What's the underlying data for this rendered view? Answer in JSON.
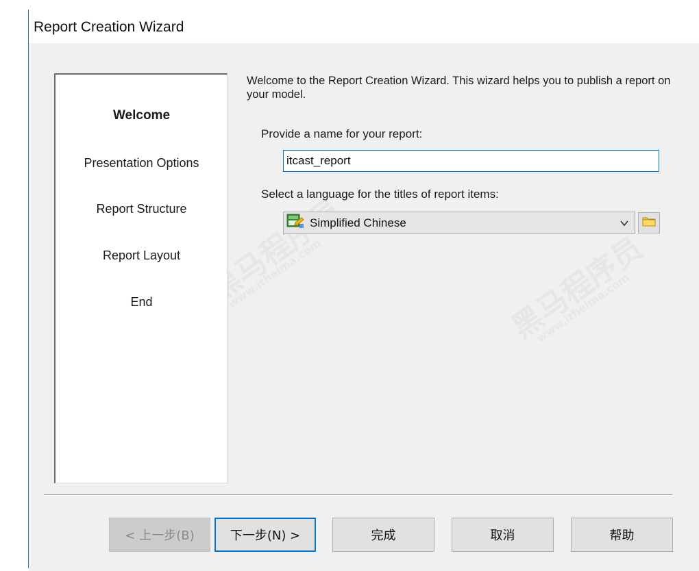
{
  "window": {
    "title": "Report Creation Wizard"
  },
  "steps": [
    {
      "label": "Welcome",
      "active": true
    },
    {
      "label": "Presentation Options",
      "active": false
    },
    {
      "label": "Report Structure",
      "active": false
    },
    {
      "label": "Report Layout",
      "active": false
    },
    {
      "label": "End",
      "active": false
    }
  ],
  "welcome": {
    "intro": "Welcome to the Report Creation Wizard. This wizard helps you to publish a report on your model.",
    "name_label": "Provide a name for your report:",
    "name_value": "itcast_report",
    "language_label": "Select a language for the titles of report items:",
    "language_value": "Simplified Chinese"
  },
  "buttons": {
    "back": "< 上一步(B)",
    "next": "下一步(N) >",
    "finish": "完成",
    "cancel": "取消",
    "help": "帮助"
  },
  "icons": {
    "language": "language-flag-icon",
    "browse": "folder-icon",
    "dropdown": "chevron-down-icon"
  },
  "watermark": {
    "text": "黑马程序员",
    "url": "www.itheima.com"
  },
  "colors": {
    "accent": "#0078d7",
    "dialog_bg": "#f0f0f0"
  }
}
